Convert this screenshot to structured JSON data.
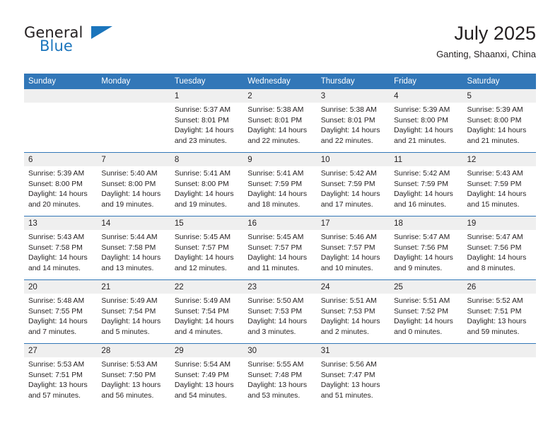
{
  "brand": {
    "name_part1": "General",
    "name_part2": "Blue",
    "triangle_icon": "triangle-icon",
    "accent_color": "#1b75bc"
  },
  "header": {
    "title": "July 2025",
    "location": "Ganting, Shaanxi, China"
  },
  "theme": {
    "header_blue": "#3277b8",
    "daynum_band": "#efefef",
    "text": "#231f20"
  },
  "calendar": {
    "weekday_headers": [
      "Sunday",
      "Monday",
      "Tuesday",
      "Wednesday",
      "Thursday",
      "Friday",
      "Saturday"
    ],
    "weeks": [
      [
        {
          "day": "",
          "lines": []
        },
        {
          "day": "",
          "lines": []
        },
        {
          "day": "1",
          "lines": [
            "Sunrise: 5:37 AM",
            "Sunset: 8:01 PM",
            "Daylight: 14 hours",
            "and 23 minutes."
          ]
        },
        {
          "day": "2",
          "lines": [
            "Sunrise: 5:38 AM",
            "Sunset: 8:01 PM",
            "Daylight: 14 hours",
            "and 22 minutes."
          ]
        },
        {
          "day": "3",
          "lines": [
            "Sunrise: 5:38 AM",
            "Sunset: 8:01 PM",
            "Daylight: 14 hours",
            "and 22 minutes."
          ]
        },
        {
          "day": "4",
          "lines": [
            "Sunrise: 5:39 AM",
            "Sunset: 8:00 PM",
            "Daylight: 14 hours",
            "and 21 minutes."
          ]
        },
        {
          "day": "5",
          "lines": [
            "Sunrise: 5:39 AM",
            "Sunset: 8:00 PM",
            "Daylight: 14 hours",
            "and 21 minutes."
          ]
        }
      ],
      [
        {
          "day": "6",
          "lines": [
            "Sunrise: 5:39 AM",
            "Sunset: 8:00 PM",
            "Daylight: 14 hours",
            "and 20 minutes."
          ]
        },
        {
          "day": "7",
          "lines": [
            "Sunrise: 5:40 AM",
            "Sunset: 8:00 PM",
            "Daylight: 14 hours",
            "and 19 minutes."
          ]
        },
        {
          "day": "8",
          "lines": [
            "Sunrise: 5:41 AM",
            "Sunset: 8:00 PM",
            "Daylight: 14 hours",
            "and 19 minutes."
          ]
        },
        {
          "day": "9",
          "lines": [
            "Sunrise: 5:41 AM",
            "Sunset: 7:59 PM",
            "Daylight: 14 hours",
            "and 18 minutes."
          ]
        },
        {
          "day": "10",
          "lines": [
            "Sunrise: 5:42 AM",
            "Sunset: 7:59 PM",
            "Daylight: 14 hours",
            "and 17 minutes."
          ]
        },
        {
          "day": "11",
          "lines": [
            "Sunrise: 5:42 AM",
            "Sunset: 7:59 PM",
            "Daylight: 14 hours",
            "and 16 minutes."
          ]
        },
        {
          "day": "12",
          "lines": [
            "Sunrise: 5:43 AM",
            "Sunset: 7:59 PM",
            "Daylight: 14 hours",
            "and 15 minutes."
          ]
        }
      ],
      [
        {
          "day": "13",
          "lines": [
            "Sunrise: 5:43 AM",
            "Sunset: 7:58 PM",
            "Daylight: 14 hours",
            "and 14 minutes."
          ]
        },
        {
          "day": "14",
          "lines": [
            "Sunrise: 5:44 AM",
            "Sunset: 7:58 PM",
            "Daylight: 14 hours",
            "and 13 minutes."
          ]
        },
        {
          "day": "15",
          "lines": [
            "Sunrise: 5:45 AM",
            "Sunset: 7:57 PM",
            "Daylight: 14 hours",
            "and 12 minutes."
          ]
        },
        {
          "day": "16",
          "lines": [
            "Sunrise: 5:45 AM",
            "Sunset: 7:57 PM",
            "Daylight: 14 hours",
            "and 11 minutes."
          ]
        },
        {
          "day": "17",
          "lines": [
            "Sunrise: 5:46 AM",
            "Sunset: 7:57 PM",
            "Daylight: 14 hours",
            "and 10 minutes."
          ]
        },
        {
          "day": "18",
          "lines": [
            "Sunrise: 5:47 AM",
            "Sunset: 7:56 PM",
            "Daylight: 14 hours",
            "and 9 minutes."
          ]
        },
        {
          "day": "19",
          "lines": [
            "Sunrise: 5:47 AM",
            "Sunset: 7:56 PM",
            "Daylight: 14 hours",
            "and 8 minutes."
          ]
        }
      ],
      [
        {
          "day": "20",
          "lines": [
            "Sunrise: 5:48 AM",
            "Sunset: 7:55 PM",
            "Daylight: 14 hours",
            "and 7 minutes."
          ]
        },
        {
          "day": "21",
          "lines": [
            "Sunrise: 5:49 AM",
            "Sunset: 7:54 PM",
            "Daylight: 14 hours",
            "and 5 minutes."
          ]
        },
        {
          "day": "22",
          "lines": [
            "Sunrise: 5:49 AM",
            "Sunset: 7:54 PM",
            "Daylight: 14 hours",
            "and 4 minutes."
          ]
        },
        {
          "day": "23",
          "lines": [
            "Sunrise: 5:50 AM",
            "Sunset: 7:53 PM",
            "Daylight: 14 hours",
            "and 3 minutes."
          ]
        },
        {
          "day": "24",
          "lines": [
            "Sunrise: 5:51 AM",
            "Sunset: 7:53 PM",
            "Daylight: 14 hours",
            "and 2 minutes."
          ]
        },
        {
          "day": "25",
          "lines": [
            "Sunrise: 5:51 AM",
            "Sunset: 7:52 PM",
            "Daylight: 14 hours",
            "and 0 minutes."
          ]
        },
        {
          "day": "26",
          "lines": [
            "Sunrise: 5:52 AM",
            "Sunset: 7:51 PM",
            "Daylight: 13 hours",
            "and 59 minutes."
          ]
        }
      ],
      [
        {
          "day": "27",
          "lines": [
            "Sunrise: 5:53 AM",
            "Sunset: 7:51 PM",
            "Daylight: 13 hours",
            "and 57 minutes."
          ]
        },
        {
          "day": "28",
          "lines": [
            "Sunrise: 5:53 AM",
            "Sunset: 7:50 PM",
            "Daylight: 13 hours",
            "and 56 minutes."
          ]
        },
        {
          "day": "29",
          "lines": [
            "Sunrise: 5:54 AM",
            "Sunset: 7:49 PM",
            "Daylight: 13 hours",
            "and 54 minutes."
          ]
        },
        {
          "day": "30",
          "lines": [
            "Sunrise: 5:55 AM",
            "Sunset: 7:48 PM",
            "Daylight: 13 hours",
            "and 53 minutes."
          ]
        },
        {
          "day": "31",
          "lines": [
            "Sunrise: 5:56 AM",
            "Sunset: 7:47 PM",
            "Daylight: 13 hours",
            "and 51 minutes."
          ]
        },
        {
          "day": "",
          "lines": []
        },
        {
          "day": "",
          "lines": []
        }
      ]
    ]
  }
}
